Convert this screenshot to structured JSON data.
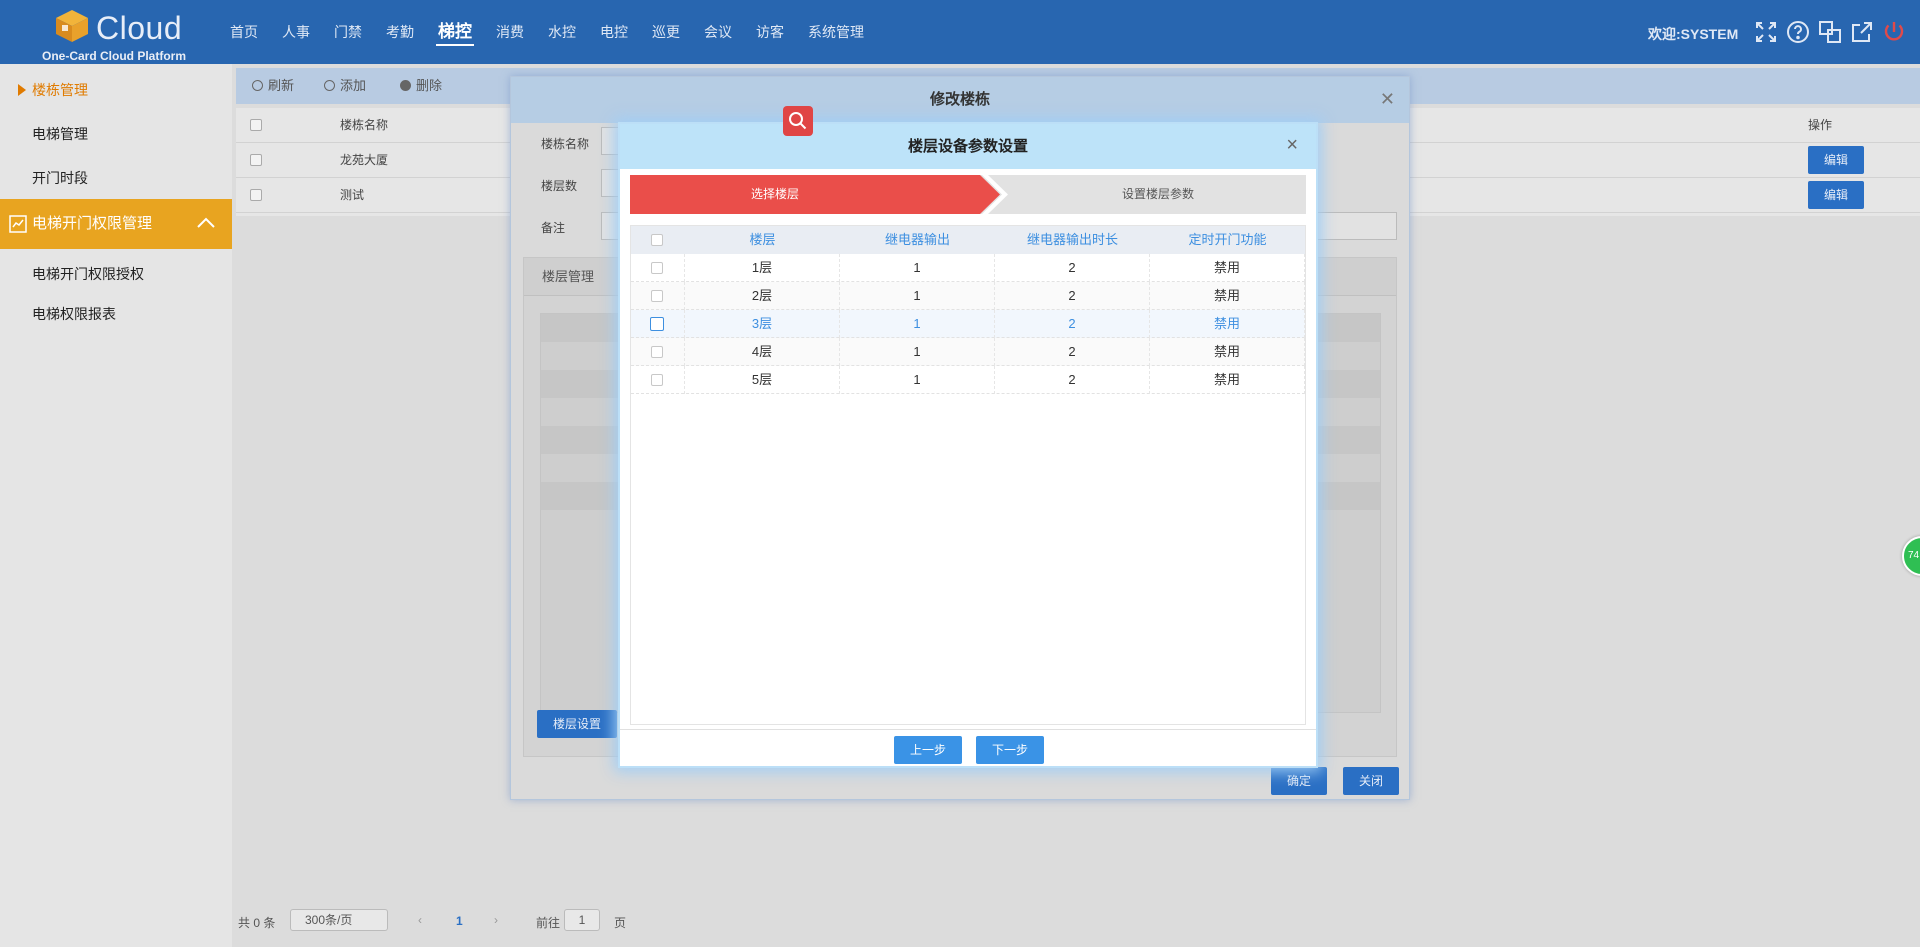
{
  "header": {
    "brand": "Cloud",
    "platform": "One-Card Cloud Platform",
    "nav": [
      "首页",
      "人事",
      "门禁",
      "考勤",
      "梯控",
      "消费",
      "水控",
      "电控",
      "巡更",
      "会议",
      "访客",
      "系统管理"
    ],
    "active_nav": "梯控",
    "welcome": "欢迎:SYSTEM",
    "icons": [
      "fullscreen-icon",
      "help-icon",
      "translate-icon",
      "external-link-icon",
      "power-icon"
    ]
  },
  "sidebar": {
    "items": [
      {
        "label": "楼栋管理"
      },
      {
        "label": "电梯管理"
      },
      {
        "label": "开门时段"
      }
    ],
    "group": {
      "label": "电梯开门权限管理"
    },
    "sub_items": [
      {
        "label": "电梯开门权限授权"
      },
      {
        "label": "电梯权限报表"
      }
    ]
  },
  "toolbar": {
    "refresh": "刷新",
    "add": "添加",
    "delete": "删除"
  },
  "grid": {
    "col_name": "楼栋名称",
    "col_ops": "操作",
    "rows": [
      {
        "name": "龙苑大厦",
        "action": "编辑"
      },
      {
        "name": "测试",
        "action": "编辑"
      }
    ]
  },
  "pager": {
    "total": "共 0 条",
    "page_size": "300条/页",
    "current": "1",
    "goto_label": "前往",
    "goto_value": "1",
    "goto_suffix": "页"
  },
  "edit_dialog": {
    "title": "修改楼栋",
    "labels": [
      "楼栋名称",
      "楼层数",
      "备注"
    ],
    "panel_title": "楼层管理",
    "floor_button": "楼层设置",
    "confirm": "确定",
    "close": "关闭"
  },
  "floor_dialog": {
    "title": "楼层设备参数设置",
    "step1": "选择楼层",
    "step2": "设置楼层参数",
    "columns": [
      "楼层",
      "继电器输出",
      "继电器输出时长",
      "定时开门功能"
    ],
    "rows": [
      {
        "floor": "1层",
        "relay": "1",
        "duration": "2",
        "timer": "禁用"
      },
      {
        "floor": "2层",
        "relay": "1",
        "duration": "2",
        "timer": "禁用"
      },
      {
        "floor": "3层",
        "relay": "1",
        "duration": "2",
        "timer": "禁用"
      },
      {
        "floor": "4层",
        "relay": "1",
        "duration": "2",
        "timer": "禁用"
      },
      {
        "floor": "5层",
        "relay": "1",
        "duration": "2",
        "timer": "禁用"
      }
    ],
    "prev": "上一步",
    "next": "下一步"
  },
  "float_badge": "74",
  "colors": {
    "header": "#2866b0",
    "accent": "#e8a420",
    "step_active": "#ea4e4a",
    "primary_button": "#3a93e6"
  }
}
